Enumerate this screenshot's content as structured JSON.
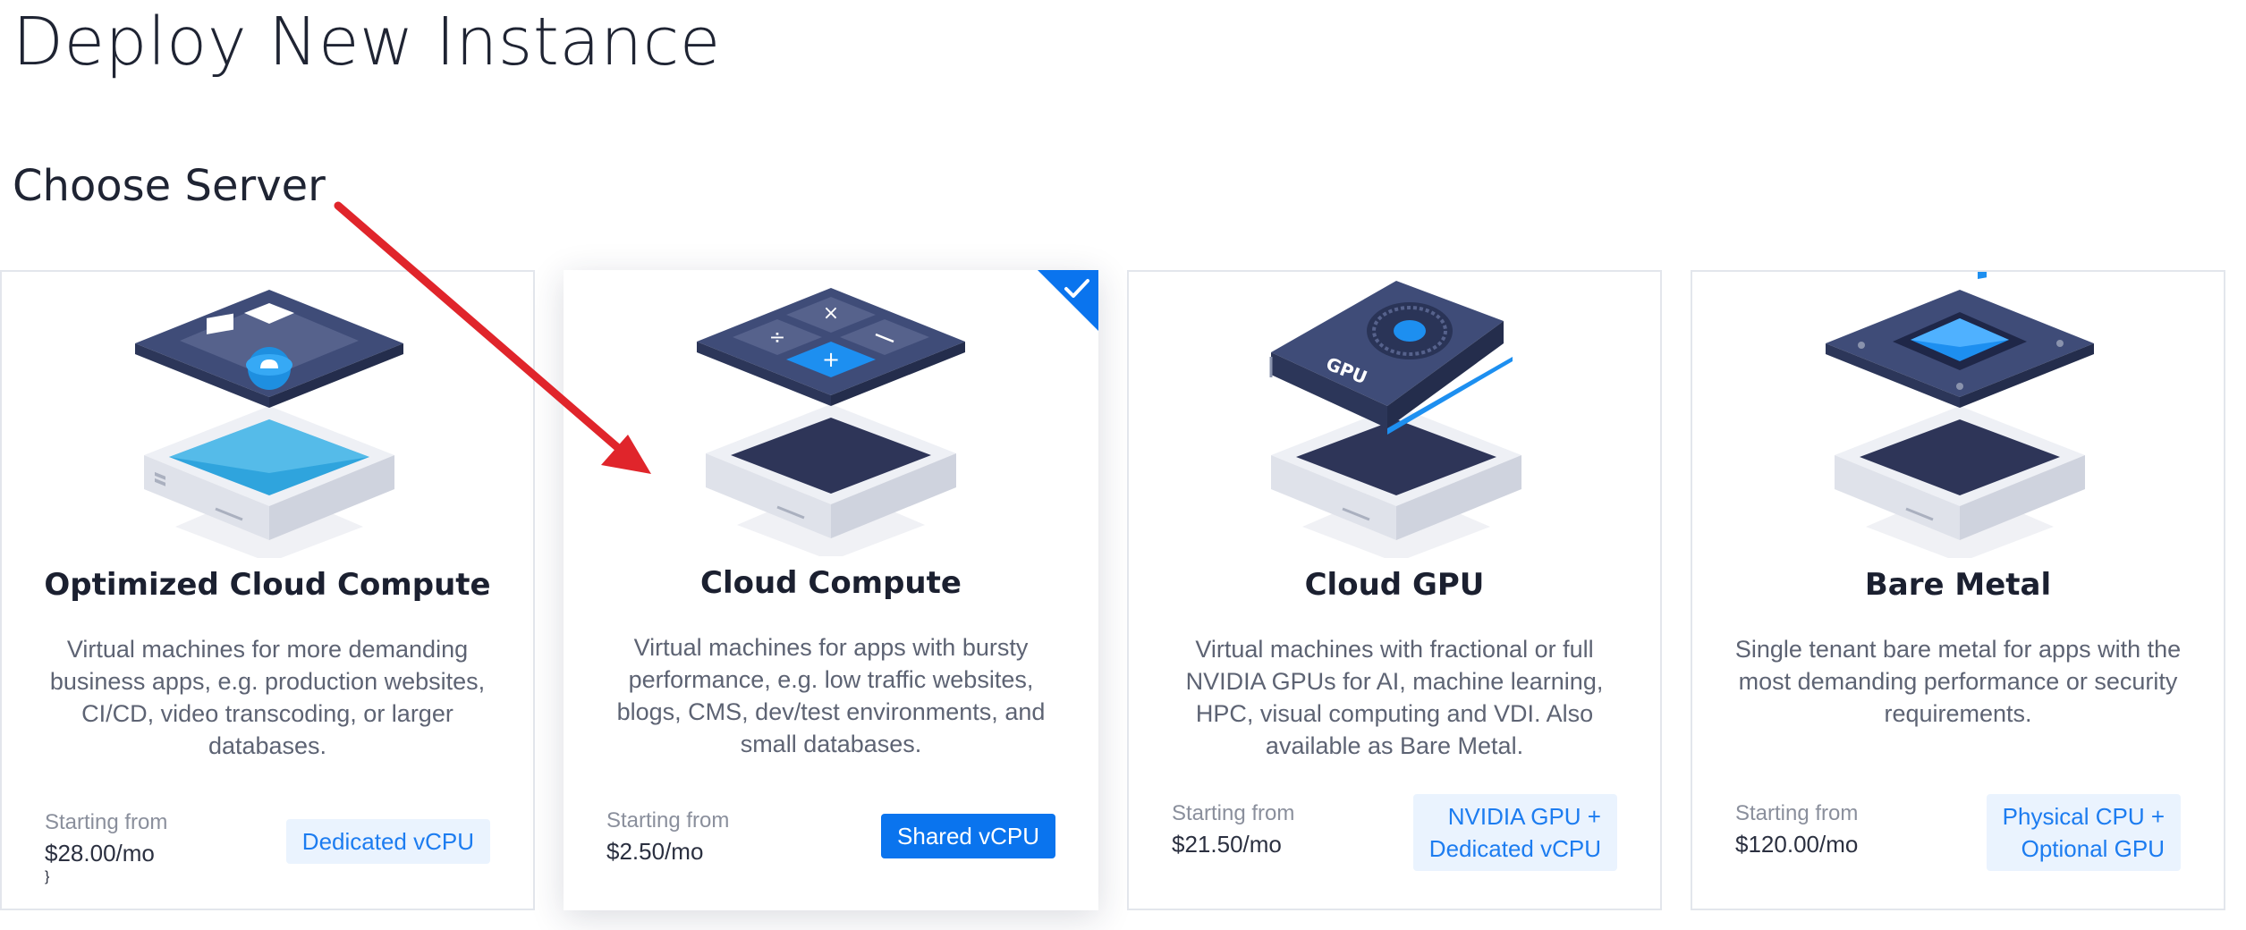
{
  "page": {
    "title": "Deploy New Instance",
    "section_title": "Choose Server"
  },
  "cards": [
    {
      "title": "Optimized Cloud Compute",
      "description": "Virtual machines for more demanding business apps, e.g. production websites, CI/CD, video transcoding, or larger databases.",
      "starting_from": "Starting from",
      "price": "$28.00/mo",
      "badge": "Dedicated vCPU",
      "selected": false,
      "icon": "cloud-chip-server-icon"
    },
    {
      "title": "Cloud Compute",
      "description": "Virtual machines for apps with bursty performance, e.g. low traffic websites, blogs, CMS, dev/test environments, and small databases.",
      "starting_from": "Starting from",
      "price": "$2.50/mo",
      "badge": "Shared vCPU",
      "selected": true,
      "icon": "calculator-server-icon"
    },
    {
      "title": "Cloud GPU",
      "description": "Virtual machines with fractional or full NVIDIA GPUs for AI, machine learning, HPC, visual computing and VDI. Also available as Bare Metal.",
      "starting_from": "Starting from",
      "price": "$21.50/mo",
      "badge_line1": "NVIDIA GPU +",
      "badge_line2": "Dedicated vCPU",
      "gpu_label": "GPU",
      "selected": false,
      "icon": "gpu-card-server-icon"
    },
    {
      "title": "Bare Metal",
      "description": "Single tenant bare metal for apps with the most demanding performance or security requirements.",
      "starting_from": "Starting from",
      "price": "$120.00/mo",
      "badge_line1": "Physical CPU +",
      "badge_line2": "Optional GPU",
      "selected": false,
      "icon": "bare-metal-chip-server-icon"
    }
  ],
  "colors": {
    "accent": "#0a74ee",
    "badge_bg": "#eaf3fe",
    "badge_text": "#1c7cf0",
    "arrow": "#e0252b",
    "card_border": "#e3e6ec"
  },
  "annotation": {
    "icon": "red-arrow-icon"
  }
}
